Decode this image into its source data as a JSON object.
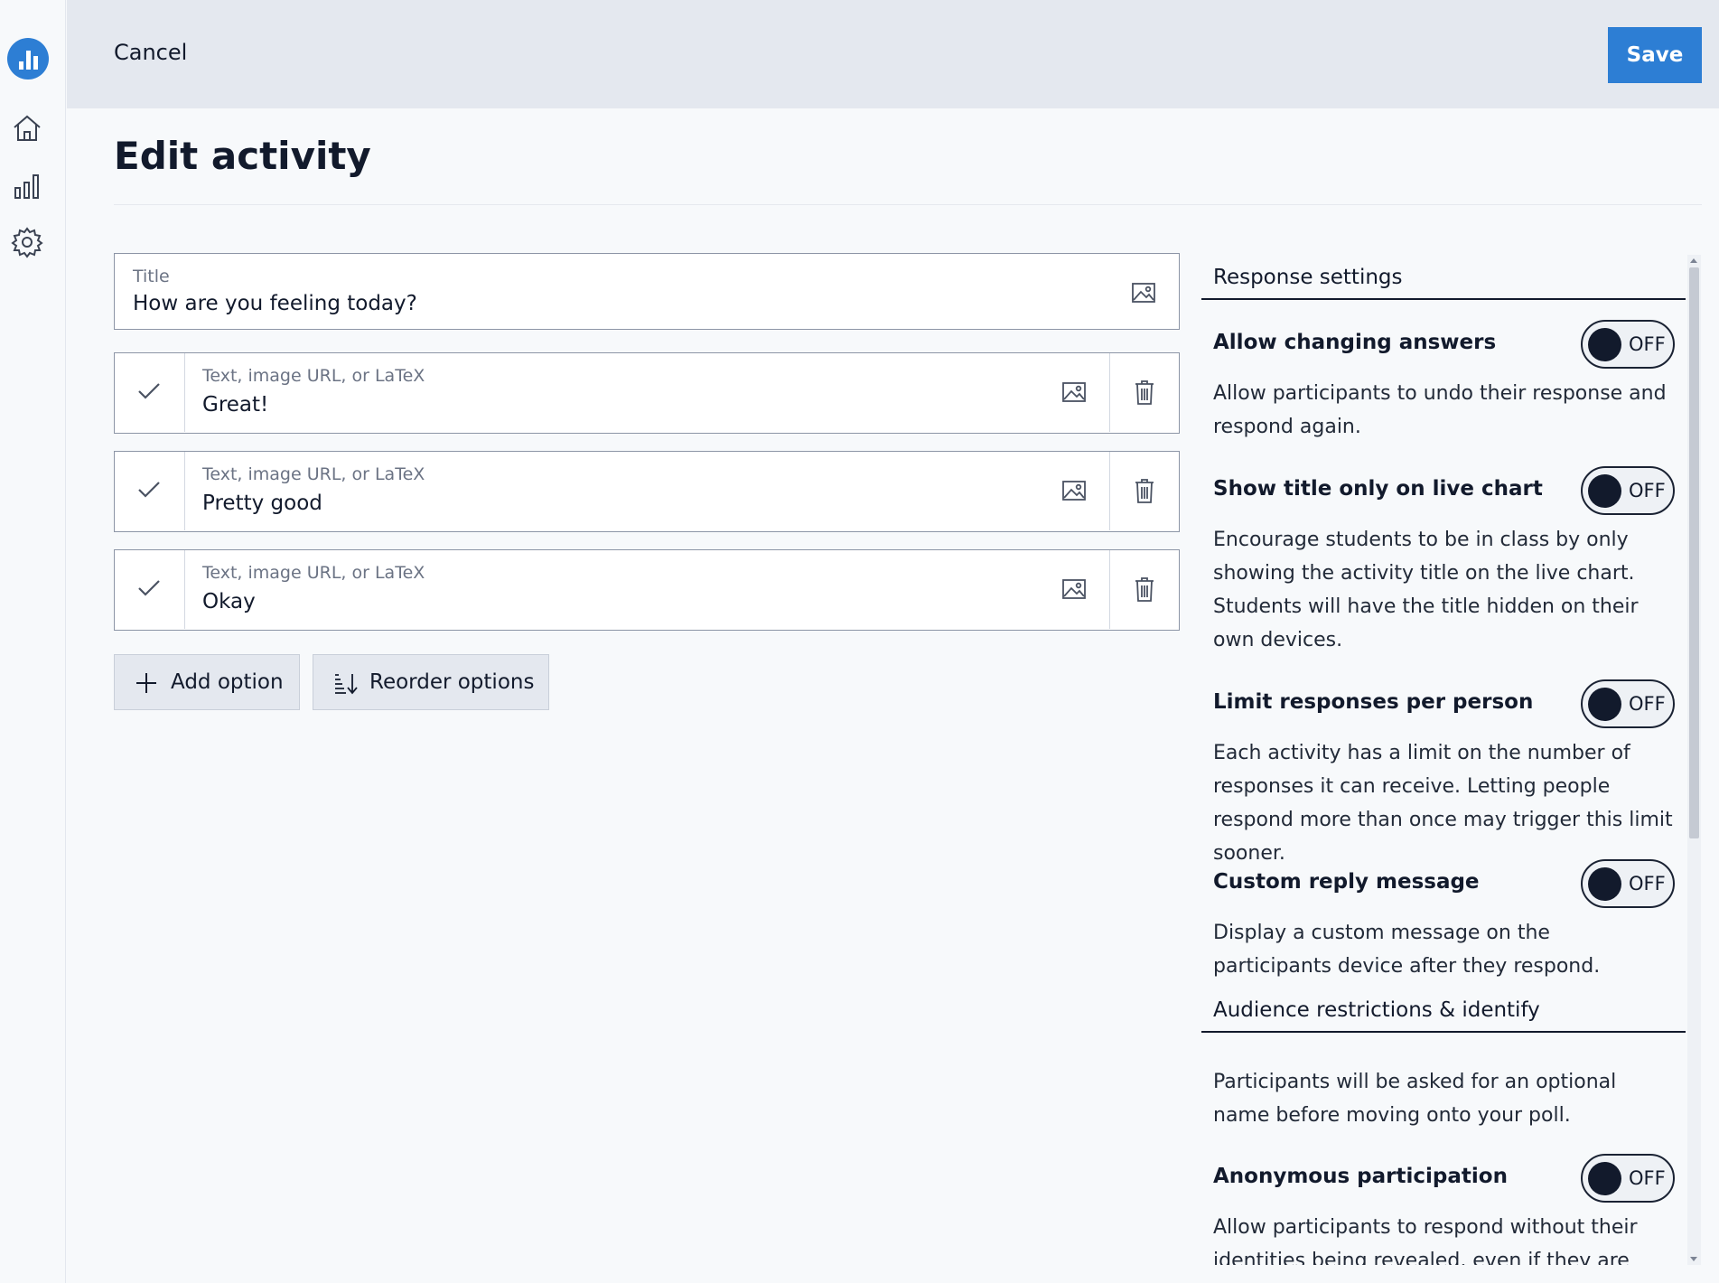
{
  "topbar": {
    "cancel_label": "Cancel",
    "save_label": "Save"
  },
  "page": {
    "title": "Edit activity"
  },
  "title_field": {
    "label": "Title",
    "value": "How are you feeling today?"
  },
  "options": [
    {
      "placeholder": "Text, image URL, or LaTeX",
      "value": "Great!"
    },
    {
      "placeholder": "Text, image URL, or LaTeX",
      "value": "Pretty good"
    },
    {
      "placeholder": "Text, image URL, or LaTeX",
      "value": "Okay"
    }
  ],
  "actions": {
    "add_option": "Add option",
    "reorder_options": "Reorder options"
  },
  "settings": {
    "response_heading": "Response settings",
    "items": [
      {
        "title": "Allow changing answers",
        "toggle": "OFF",
        "desc": "Allow participants to undo their response and respond again."
      },
      {
        "title": "Show title only on live chart",
        "toggle": "OFF",
        "desc": "Encourage students to be in class by only showing the activity title on the live chart. Students will have the title hidden on their own devices."
      },
      {
        "title": "Limit responses per person",
        "toggle": "OFF",
        "desc": "Each activity has a limit on the number of responses it can receive. Letting people respond more than once may trigger this limit sooner."
      },
      {
        "title": "Custom reply message",
        "toggle": "OFF",
        "desc": "Display a custom message on the participants device after they respond."
      }
    ],
    "audience_heading": "Audience restrictions & identify",
    "audience_desc": "Participants will be asked for an optional name before moving onto your poll.",
    "anon": {
      "title": "Anonymous participation",
      "toggle": "OFF",
      "desc": "Allow participants to respond without their identities being revealed, even if they are"
    }
  },
  "icons": {
    "logo": "bar-chart-logo-icon",
    "home": "home-icon",
    "activity": "bar-chart-icon",
    "settings": "gear-icon",
    "image": "image-icon",
    "check": "check-icon",
    "trash": "trash-icon",
    "plus": "plus-icon",
    "reorder": "reorder-icon"
  },
  "colors": {
    "accent": "#2d7ed4",
    "topbar": "#e4e8ef",
    "text": "#121a2c"
  }
}
